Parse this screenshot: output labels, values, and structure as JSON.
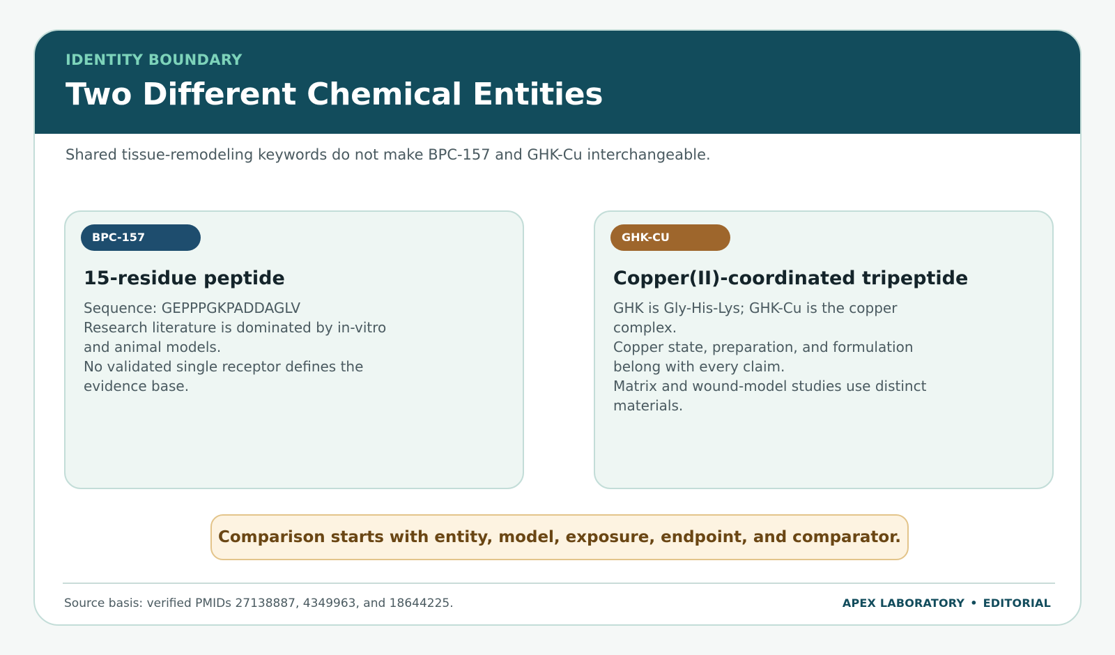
{
  "header": {
    "eyebrow": "IDENTITY BOUNDARY",
    "title": "Two Different Chemical Entities"
  },
  "subtitle": "Shared tissue-remodeling keywords do not make BPC-157 and GHK-Cu interchangeable.",
  "panels": [
    {
      "badge": "BPC-157",
      "title": "15-residue peptide",
      "lines": [
        "Sequence: GEPPPGKPADDAGLV",
        "Research literature is dominated by in-vitro and animal models.",
        "No validated single receptor defines the evidence base."
      ]
    },
    {
      "badge": "GHK-CU",
      "title": "Copper(II)-coordinated tripeptide",
      "lines": [
        "GHK is Gly-His-Lys; GHK-Cu is the copper complex.",
        "Copper state, preparation, and formulation belong with every claim.",
        "Matrix and wound-model studies use distinct materials."
      ]
    }
  ],
  "callout": "Comparison starts with entity, model, exposure, endpoint, and comparator.",
  "footer": {
    "source": "Source basis: verified PMIDs 27138887, 4349963, and 18644225.",
    "brand": "APEX LABORATORY",
    "separator": "•",
    "section": "EDITORIAL"
  },
  "colors": {
    "header_bg": "#124c5c",
    "eyebrow": "#7dd3ba",
    "badge_bpc": "#1e4d6e",
    "badge_ghk": "#9e662c",
    "callout_bg": "#fdf3e1",
    "callout_text": "#6a4614"
  }
}
